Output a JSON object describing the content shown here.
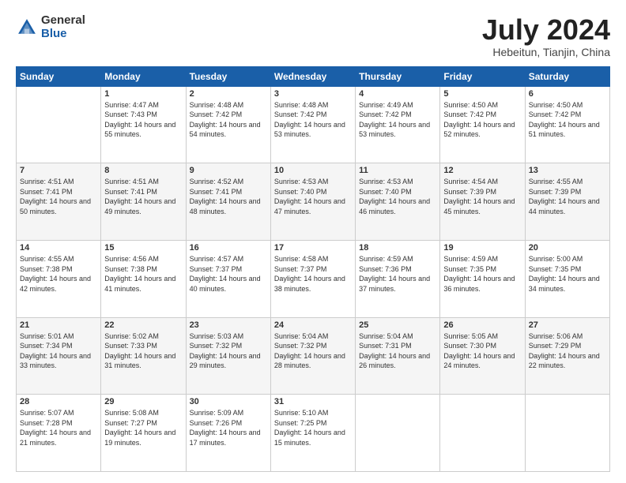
{
  "logo": {
    "general": "General",
    "blue": "Blue"
  },
  "title": "July 2024",
  "subtitle": "Hebeitun, Tianjin, China",
  "days_header": [
    "Sunday",
    "Monday",
    "Tuesday",
    "Wednesday",
    "Thursday",
    "Friday",
    "Saturday"
  ],
  "weeks": [
    [
      {
        "day": "",
        "sunrise": "",
        "sunset": "",
        "daylight": ""
      },
      {
        "day": "1",
        "sunrise": "Sunrise: 4:47 AM",
        "sunset": "Sunset: 7:43 PM",
        "daylight": "Daylight: 14 hours and 55 minutes."
      },
      {
        "day": "2",
        "sunrise": "Sunrise: 4:48 AM",
        "sunset": "Sunset: 7:42 PM",
        "daylight": "Daylight: 14 hours and 54 minutes."
      },
      {
        "day": "3",
        "sunrise": "Sunrise: 4:48 AM",
        "sunset": "Sunset: 7:42 PM",
        "daylight": "Daylight: 14 hours and 53 minutes."
      },
      {
        "day": "4",
        "sunrise": "Sunrise: 4:49 AM",
        "sunset": "Sunset: 7:42 PM",
        "daylight": "Daylight: 14 hours and 53 minutes."
      },
      {
        "day": "5",
        "sunrise": "Sunrise: 4:50 AM",
        "sunset": "Sunset: 7:42 PM",
        "daylight": "Daylight: 14 hours and 52 minutes."
      },
      {
        "day": "6",
        "sunrise": "Sunrise: 4:50 AM",
        "sunset": "Sunset: 7:42 PM",
        "daylight": "Daylight: 14 hours and 51 minutes."
      }
    ],
    [
      {
        "day": "7",
        "sunrise": "Sunrise: 4:51 AM",
        "sunset": "Sunset: 7:41 PM",
        "daylight": "Daylight: 14 hours and 50 minutes."
      },
      {
        "day": "8",
        "sunrise": "Sunrise: 4:51 AM",
        "sunset": "Sunset: 7:41 PM",
        "daylight": "Daylight: 14 hours and 49 minutes."
      },
      {
        "day": "9",
        "sunrise": "Sunrise: 4:52 AM",
        "sunset": "Sunset: 7:41 PM",
        "daylight": "Daylight: 14 hours and 48 minutes."
      },
      {
        "day": "10",
        "sunrise": "Sunrise: 4:53 AM",
        "sunset": "Sunset: 7:40 PM",
        "daylight": "Daylight: 14 hours and 47 minutes."
      },
      {
        "day": "11",
        "sunrise": "Sunrise: 4:53 AM",
        "sunset": "Sunset: 7:40 PM",
        "daylight": "Daylight: 14 hours and 46 minutes."
      },
      {
        "day": "12",
        "sunrise": "Sunrise: 4:54 AM",
        "sunset": "Sunset: 7:39 PM",
        "daylight": "Daylight: 14 hours and 45 minutes."
      },
      {
        "day": "13",
        "sunrise": "Sunrise: 4:55 AM",
        "sunset": "Sunset: 7:39 PM",
        "daylight": "Daylight: 14 hours and 44 minutes."
      }
    ],
    [
      {
        "day": "14",
        "sunrise": "Sunrise: 4:55 AM",
        "sunset": "Sunset: 7:38 PM",
        "daylight": "Daylight: 14 hours and 42 minutes."
      },
      {
        "day": "15",
        "sunrise": "Sunrise: 4:56 AM",
        "sunset": "Sunset: 7:38 PM",
        "daylight": "Daylight: 14 hours and 41 minutes."
      },
      {
        "day": "16",
        "sunrise": "Sunrise: 4:57 AM",
        "sunset": "Sunset: 7:37 PM",
        "daylight": "Daylight: 14 hours and 40 minutes."
      },
      {
        "day": "17",
        "sunrise": "Sunrise: 4:58 AM",
        "sunset": "Sunset: 7:37 PM",
        "daylight": "Daylight: 14 hours and 38 minutes."
      },
      {
        "day": "18",
        "sunrise": "Sunrise: 4:59 AM",
        "sunset": "Sunset: 7:36 PM",
        "daylight": "Daylight: 14 hours and 37 minutes."
      },
      {
        "day": "19",
        "sunrise": "Sunrise: 4:59 AM",
        "sunset": "Sunset: 7:35 PM",
        "daylight": "Daylight: 14 hours and 36 minutes."
      },
      {
        "day": "20",
        "sunrise": "Sunrise: 5:00 AM",
        "sunset": "Sunset: 7:35 PM",
        "daylight": "Daylight: 14 hours and 34 minutes."
      }
    ],
    [
      {
        "day": "21",
        "sunrise": "Sunrise: 5:01 AM",
        "sunset": "Sunset: 7:34 PM",
        "daylight": "Daylight: 14 hours and 33 minutes."
      },
      {
        "day": "22",
        "sunrise": "Sunrise: 5:02 AM",
        "sunset": "Sunset: 7:33 PM",
        "daylight": "Daylight: 14 hours and 31 minutes."
      },
      {
        "day": "23",
        "sunrise": "Sunrise: 5:03 AM",
        "sunset": "Sunset: 7:32 PM",
        "daylight": "Daylight: 14 hours and 29 minutes."
      },
      {
        "day": "24",
        "sunrise": "Sunrise: 5:04 AM",
        "sunset": "Sunset: 7:32 PM",
        "daylight": "Daylight: 14 hours and 28 minutes."
      },
      {
        "day": "25",
        "sunrise": "Sunrise: 5:04 AM",
        "sunset": "Sunset: 7:31 PM",
        "daylight": "Daylight: 14 hours and 26 minutes."
      },
      {
        "day": "26",
        "sunrise": "Sunrise: 5:05 AM",
        "sunset": "Sunset: 7:30 PM",
        "daylight": "Daylight: 14 hours and 24 minutes."
      },
      {
        "day": "27",
        "sunrise": "Sunrise: 5:06 AM",
        "sunset": "Sunset: 7:29 PM",
        "daylight": "Daylight: 14 hours and 22 minutes."
      }
    ],
    [
      {
        "day": "28",
        "sunrise": "Sunrise: 5:07 AM",
        "sunset": "Sunset: 7:28 PM",
        "daylight": "Daylight: 14 hours and 21 minutes."
      },
      {
        "day": "29",
        "sunrise": "Sunrise: 5:08 AM",
        "sunset": "Sunset: 7:27 PM",
        "daylight": "Daylight: 14 hours and 19 minutes."
      },
      {
        "day": "30",
        "sunrise": "Sunrise: 5:09 AM",
        "sunset": "Sunset: 7:26 PM",
        "daylight": "Daylight: 14 hours and 17 minutes."
      },
      {
        "day": "31",
        "sunrise": "Sunrise: 5:10 AM",
        "sunset": "Sunset: 7:25 PM",
        "daylight": "Daylight: 14 hours and 15 minutes."
      },
      {
        "day": "",
        "sunrise": "",
        "sunset": "",
        "daylight": ""
      },
      {
        "day": "",
        "sunrise": "",
        "sunset": "",
        "daylight": ""
      },
      {
        "day": "",
        "sunrise": "",
        "sunset": "",
        "daylight": ""
      }
    ]
  ]
}
